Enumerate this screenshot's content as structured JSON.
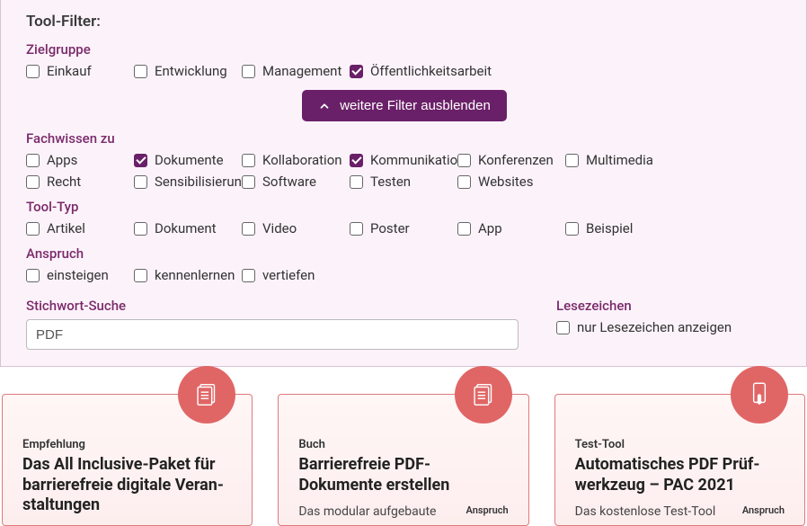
{
  "panel": {
    "title": "Tool-Filter:",
    "toggle_label": "weitere Filter ausblenden"
  },
  "zielgruppe": {
    "label": "Zielgruppe",
    "items": [
      {
        "label": "Einkauf",
        "checked": false
      },
      {
        "label": "Entwicklung",
        "checked": false
      },
      {
        "label": "Management",
        "checked": false
      },
      {
        "label": "Öffentlichkeitsarbeit",
        "checked": true
      }
    ]
  },
  "fachwissen": {
    "label": "Fachwissen zu",
    "items": [
      {
        "label": "Apps",
        "checked": false
      },
      {
        "label": "Dokumente",
        "checked": true
      },
      {
        "label": "Kollaboration",
        "checked": false
      },
      {
        "label": "Kommunikation",
        "checked": true
      },
      {
        "label": "Konferenzen",
        "checked": false
      },
      {
        "label": "Multimedia",
        "checked": false
      },
      {
        "label": "Recht",
        "checked": false
      },
      {
        "label": "Sensibilisierung",
        "checked": false
      },
      {
        "label": "Software",
        "checked": false
      },
      {
        "label": "Testen",
        "checked": false
      },
      {
        "label": "Websites",
        "checked": false
      }
    ]
  },
  "tooltyp": {
    "label": "Tool-Typ",
    "items": [
      {
        "label": "Artikel",
        "checked": false
      },
      {
        "label": "Dokument",
        "checked": false
      },
      {
        "label": "Video",
        "checked": false
      },
      {
        "label": "Poster",
        "checked": false
      },
      {
        "label": "App",
        "checked": false
      },
      {
        "label": "Beispiel",
        "checked": false
      }
    ]
  },
  "anspruch": {
    "label": "Anspruch",
    "items": [
      {
        "label": "einsteigen",
        "checked": false
      },
      {
        "label": "kennenlernen",
        "checked": false
      },
      {
        "label": "vertiefen",
        "checked": false
      }
    ]
  },
  "search": {
    "label": "Stichwort-Suche",
    "value": "PDF"
  },
  "bookmark": {
    "label": "Lesezeichen",
    "option": "nur Lesezeichen anzeigen",
    "checked": false
  },
  "cards": [
    {
      "eyebrow": "Empfehlung",
      "title": "Das All Inclusive-Paket für barrierefreie digitale Veran­staltungen",
      "desc": "",
      "anspruch_label": "",
      "icon": "documents"
    },
    {
      "eyebrow": "Buch",
      "title": "Barrierefreie PDF-Dokumente erstellen",
      "desc": "Das modular aufgebaute",
      "anspruch_label": "Anspruch",
      "icon": "documents"
    },
    {
      "eyebrow": "Test-Tool",
      "title": "Automatisches PDF Prüf­werkzeug – PAC 2021",
      "desc": "Das kostenlose Test-Tool",
      "anspruch_label": "Anspruch",
      "icon": "touch"
    }
  ]
}
